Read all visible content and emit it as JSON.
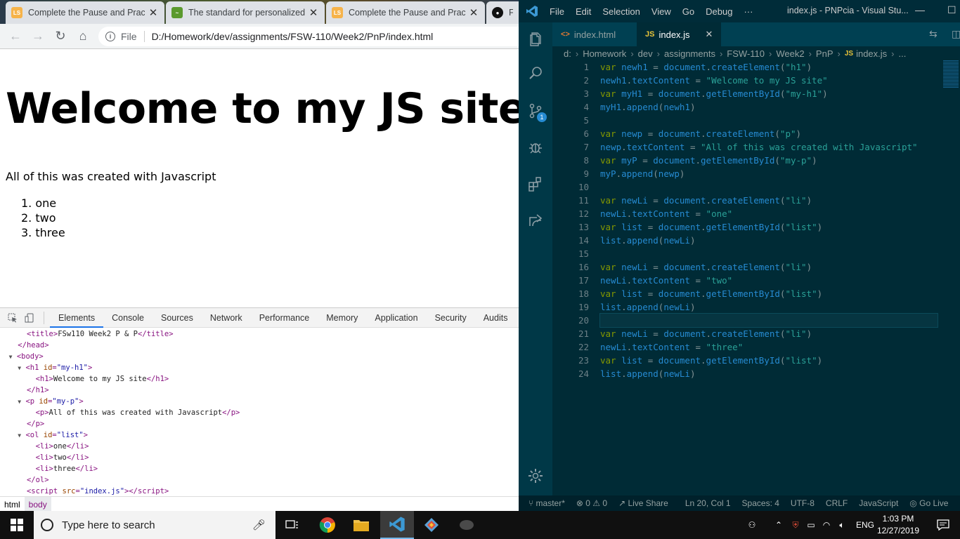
{
  "browser": {
    "tabs": [
      {
        "title": "Complete the Pause and Practi",
        "favicon": "ls-logo"
      },
      {
        "title": "The standard for personalized",
        "favicon": "chart-logo"
      },
      {
        "title": "Complete the Pause and Practi",
        "favicon": "ls-logo"
      },
      {
        "title": "FS",
        "favicon": "github-icon"
      }
    ],
    "omnibox": {
      "scheme_label": "File",
      "url": "D:/Homework/dev/assignments/FSW-110/Week2/PnP/index.html"
    },
    "page": {
      "h1": "Welcome to my JS site",
      "p": "All of this was created with Javascript",
      "list": [
        "1. one",
        "2. two",
        "3. three"
      ]
    }
  },
  "devtools": {
    "tabs": [
      "Elements",
      "Console",
      "Sources",
      "Network",
      "Performance",
      "Memory",
      "Application",
      "Security",
      "Audits"
    ],
    "active_tab": "Elements",
    "breadcrumb": [
      "html",
      "body"
    ]
  },
  "vscode": {
    "menu": [
      "File",
      "Edit",
      "Selection",
      "View",
      "Go",
      "Debug",
      "···"
    ],
    "window_title": "index.js - PNPcia - Visual Stu...",
    "tabs": [
      {
        "label": "index.html",
        "icon": "<>"
      },
      {
        "label": "index.js",
        "icon": "JS"
      }
    ],
    "breadcrumb": [
      "d:",
      "Homework",
      "dev",
      "assignments",
      "FSW-110",
      "Week2",
      "PnP",
      "index.js",
      "..."
    ],
    "scm_badge": "1",
    "status": {
      "branch": "master*",
      "problems": "⊗ 0 ⚠ 0",
      "live_share": "Live Share",
      "position": "Ln 20, Col 1",
      "spaces": "Spaces: 4",
      "encoding": "UTF-8",
      "eol": "CRLF",
      "language": "JavaScript",
      "go_live": "Go Live"
    }
  },
  "taskbar": {
    "search_placeholder": "Type here to search",
    "language": "ENG",
    "time": "1:03 PM",
    "date": "12/27/2019"
  }
}
